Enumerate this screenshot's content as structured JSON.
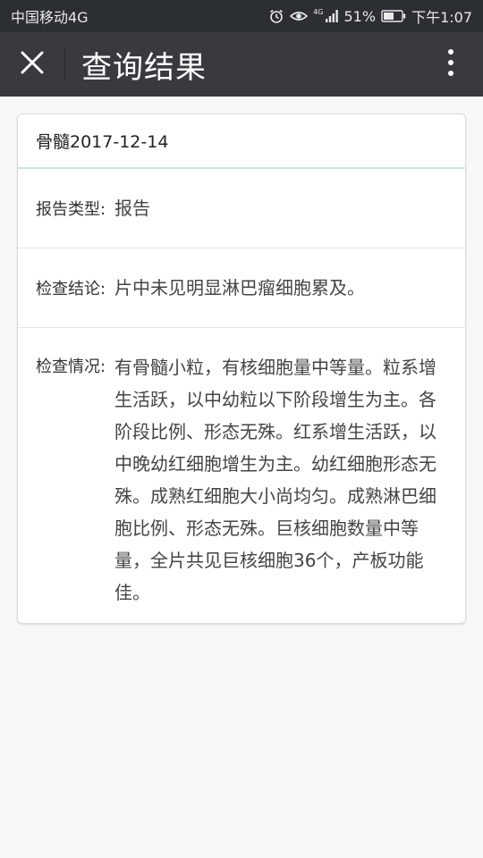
{
  "status_bar": {
    "carrier": "中国移动4G",
    "network": "4G",
    "battery": "51%",
    "time": "下午1:07"
  },
  "navbar": {
    "title": "查询结果",
    "icons": [
      "close-icon",
      "more-vertical-icon"
    ]
  },
  "report": {
    "header": "骨髓2017-12-14",
    "rows": [
      {
        "label": "报告类型:",
        "value": "报告"
      },
      {
        "label": "检查结论:",
        "value": "片中未见明显淋巴瘤细胞累及。"
      },
      {
        "label": "检查情况:",
        "value": "有骨髓小粒，有核细胞量中等量。粒系增生活跃，以中幼粒以下阶段增生为主。各阶段比例、形态无殊。红系增生活跃，以中晚幼红细胞增生为主。幼红细胞形态无殊。成熟红细胞大小尚均匀。成熟淋巴细胞比例、形态无殊。巨核细胞数量中等量，全片共见巨核细胞36个，产板功能佳。"
      }
    ]
  },
  "colors": {
    "status_bg": "#2b2e33",
    "nav_bg": "#393a3f",
    "page_bg": "#f7f7f7",
    "card_border": "#dcdcdc",
    "header_underline": "#cfe3ea"
  }
}
